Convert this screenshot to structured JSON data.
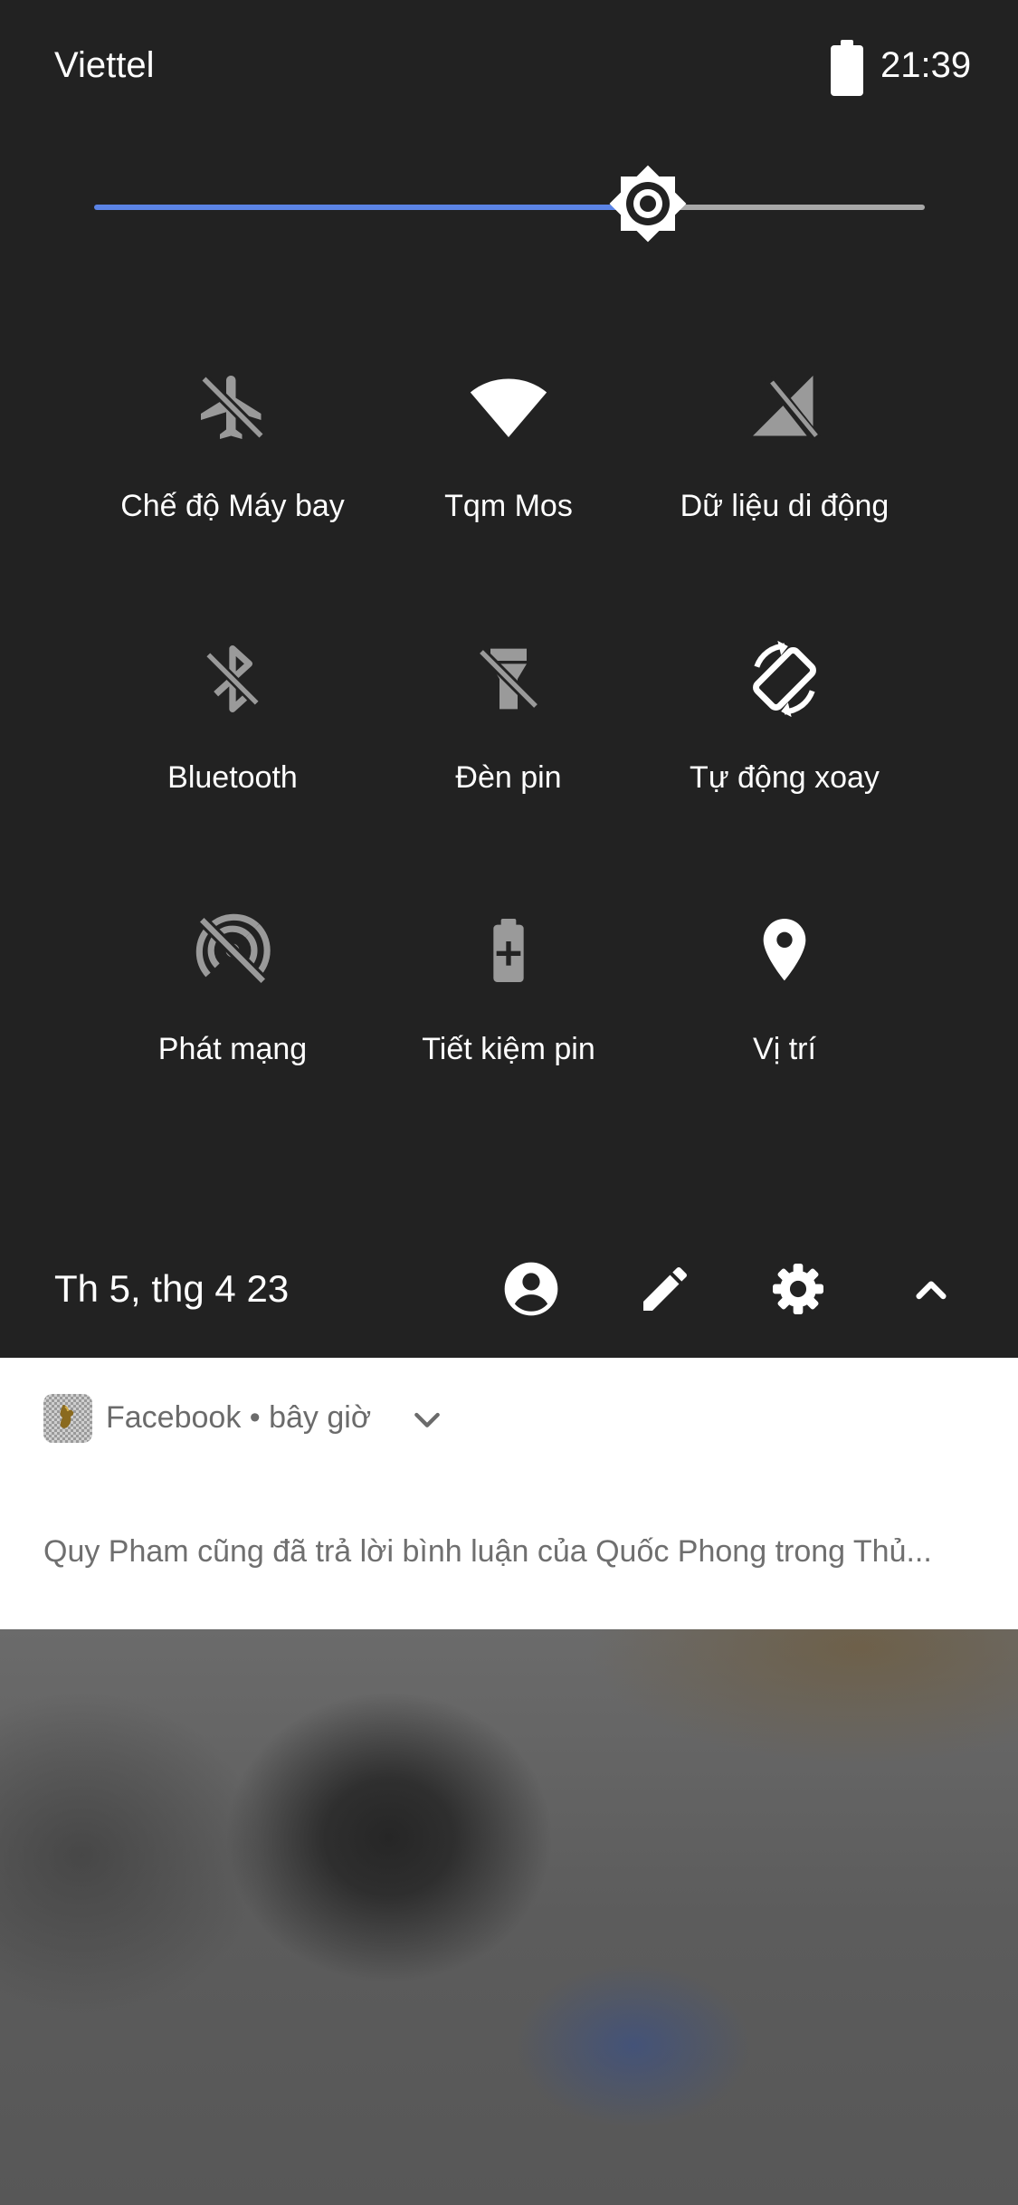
{
  "status_bar": {
    "carrier": "Viettel",
    "time": "21:39"
  },
  "brightness": {
    "level": 0.665,
    "icon": "brightness-icon"
  },
  "tiles": [
    {
      "label": "Chế độ Máy bay",
      "icon": "airplane-off-icon",
      "active": false
    },
    {
      "label": "Tqm Mos",
      "icon": "wifi-icon",
      "active": true
    },
    {
      "label": "Dữ liệu di động",
      "icon": "mobile-data-off-icon",
      "active": false
    },
    {
      "label": "Bluetooth",
      "icon": "bluetooth-off-icon",
      "active": false
    },
    {
      "label": "Đèn pin",
      "icon": "flashlight-off-icon",
      "active": false
    },
    {
      "label": "Tự động xoay",
      "icon": "auto-rotate-icon",
      "active": true
    },
    {
      "label": "Phát mạng",
      "icon": "hotspot-off-icon",
      "active": false
    },
    {
      "label": "Tiết kiệm pin",
      "icon": "battery-saver-icon",
      "active": false
    },
    {
      "label": "Vị trí",
      "icon": "location-icon",
      "active": true
    }
  ],
  "footer": {
    "date": "Th 5, thg 4 23"
  },
  "notification": {
    "app_line": "Facebook • bây giờ",
    "body": "Quy Pham cũng đã trả lời bình luận của Quốc Phong trong Thủ..."
  },
  "colors": {
    "panel": "#222222",
    "accent": "#5b84e6",
    "inactive_icon": "#9a9a9a",
    "active_icon": "#ffffff"
  }
}
